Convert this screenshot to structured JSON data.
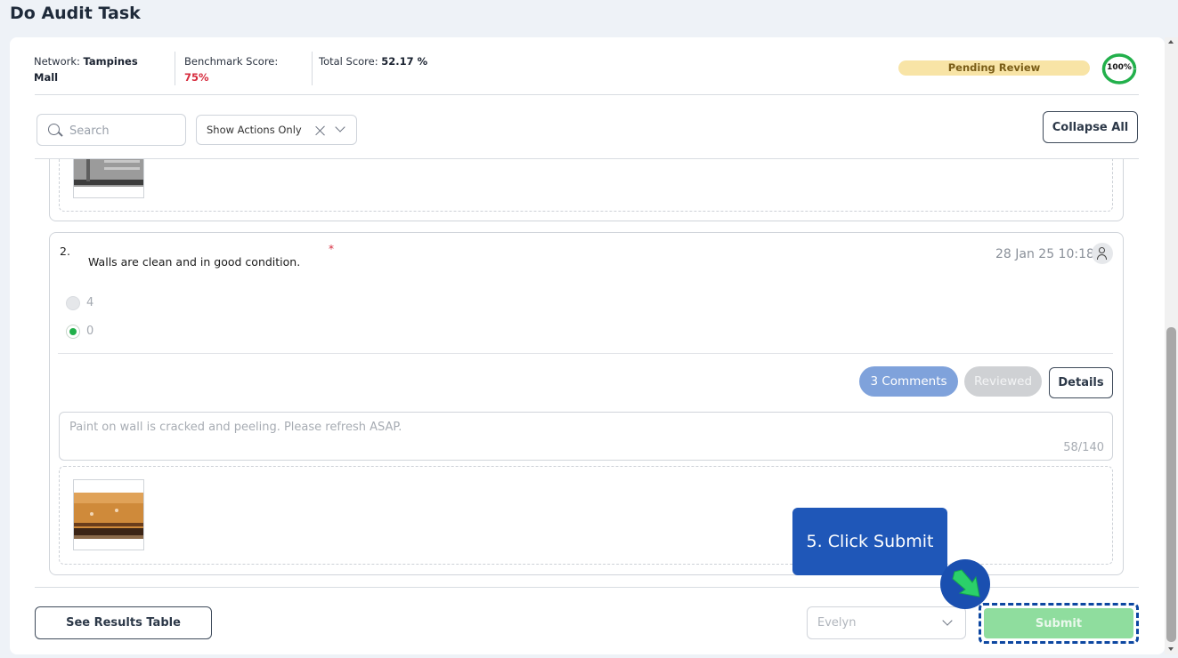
{
  "page": {
    "title": "Do Audit Task"
  },
  "header": {
    "network_label": "Network:",
    "network_value_line1": "Tampines",
    "network_value_line2": "Mall",
    "benchmark_label": "Benchmark Score:",
    "benchmark_value": "75%",
    "total_label": "Total Score:",
    "total_value": "52.17 %",
    "status": "Pending Review",
    "progress_label": "100%",
    "progress_value": 1.0
  },
  "filters": {
    "search_placeholder": "Search",
    "show_filter_label": "Show Actions Only",
    "collapse_label": "Collapse All"
  },
  "question": {
    "number": "2.",
    "text": "Walls are clean and in good condition.",
    "required_mark": "*",
    "timestamp": "28 Jan 25 10:18",
    "options": [
      {
        "label": "4",
        "selected": false
      },
      {
        "label": "0",
        "selected": true
      }
    ],
    "comments_label": "3 Comments",
    "reviewed_label": "Reviewed",
    "details_label": "Details",
    "comment_text": "Paint on wall is cracked and peeling. Please refresh ASAP.",
    "char_count": "58/140"
  },
  "footer": {
    "see_results_label": "See Results Table",
    "assignee_value": "Evelyn",
    "submit_label": "Submit"
  },
  "tutorial": {
    "tooltip": "5. Click Submit"
  },
  "colors": {
    "accent_blue": "#1f57b8",
    "success_green": "#22b04b",
    "submit_green": "#8fdd9e",
    "alert_red": "#d62a3c",
    "pending_yellow": "#f8e4a6"
  }
}
